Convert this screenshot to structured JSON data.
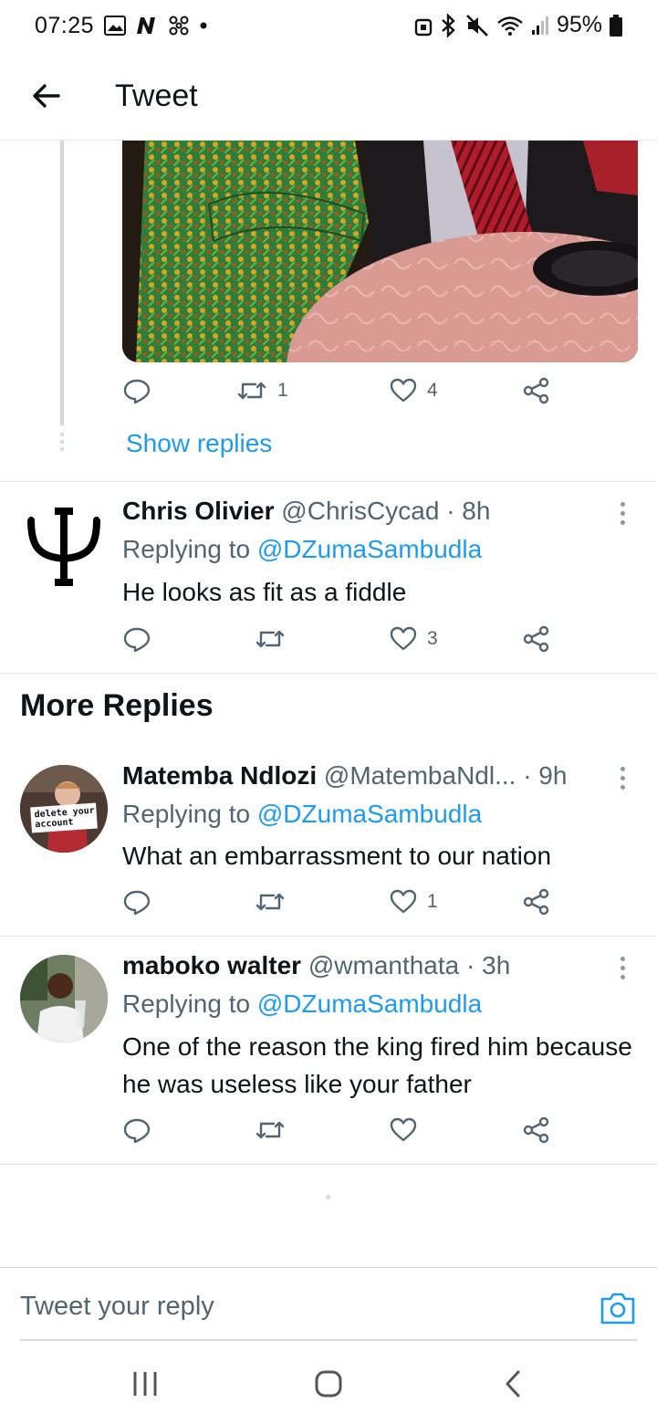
{
  "status_bar": {
    "time": "07:25",
    "battery": "95%",
    "icons_left": [
      "gallery-icon",
      "n-app-icon",
      "fan-icon",
      "dot"
    ],
    "icons_right": [
      "lock-icon",
      "bluetooth-icon",
      "mute-icon",
      "wifi-icon",
      "signal-icon",
      "battery-icon"
    ]
  },
  "header": {
    "title": "Tweet"
  },
  "first_tweet": {
    "retweets": "1",
    "likes": "4",
    "show_replies": "Show replies"
  },
  "replies": [
    {
      "name": "Chris Olivier",
      "handle": "@ChrisCycad · 8h",
      "replying_prefix": "Replying to ",
      "mention": "@DZumaSambudla",
      "text": "He looks as fit as a fiddle",
      "retweets": "",
      "likes": "3",
      "avatar": "psi-symbol"
    }
  ],
  "more_replies": {
    "title": "More Replies",
    "items": [
      {
        "name": "Matemba Ndlozi",
        "handle": "@MatembaNdl... · 9h",
        "replying_prefix": "Replying to ",
        "mention": "@DZumaSambudla",
        "text": "What an embarrassment to our nation",
        "likes": "1",
        "avatar_sign_line1": "delete your",
        "avatar_sign_line2": "account"
      },
      {
        "name": "maboko walter",
        "handle": "@wmanthata · 3h",
        "replying_prefix": "Replying to ",
        "mention": "@DZumaSambudla",
        "text": "One of the reason the king fired him because he was useless like your father",
        "likes": ""
      }
    ]
  },
  "composer": {
    "placeholder": "Tweet your reply"
  },
  "colors": {
    "link": "#1d9bf0",
    "secondary_text": "#536471",
    "primary_text": "#0f1419"
  }
}
